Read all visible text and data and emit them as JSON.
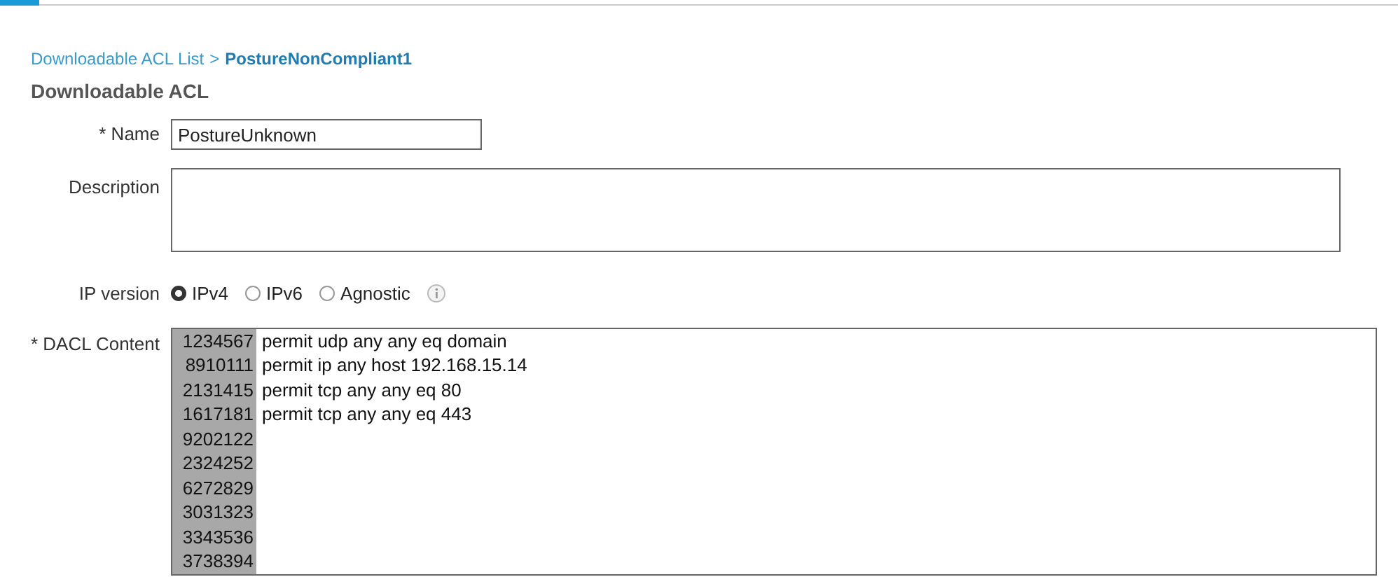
{
  "breadcrumb": {
    "link": "Downloadable ACL List",
    "separator": ">",
    "current": "PostureNonCompliant1"
  },
  "heading": "Downloadable ACL",
  "name_field": {
    "label": "* Name",
    "value": "PostureUnknown"
  },
  "description_field": {
    "label": "Description"
  },
  "ip_version": {
    "label": "IP version",
    "options": [
      {
        "label": "IPv4",
        "selected": true
      },
      {
        "label": "IPv6",
        "selected": false
      },
      {
        "label": "Agnostic",
        "selected": false
      }
    ]
  },
  "dacl_content": {
    "label": "* DACL Content",
    "line_numbers": [
      "1234567",
      "8910111",
      "2131415",
      "1617181",
      "9202122",
      "2324252",
      "6272829",
      "3031323",
      "3343536",
      "3738394"
    ],
    "lines": [
      "permit udp any any eq domain",
      "permit ip any host 192.168.15.14",
      "permit tcp any any eq 80",
      "permit tcp any any eq 443"
    ]
  }
}
